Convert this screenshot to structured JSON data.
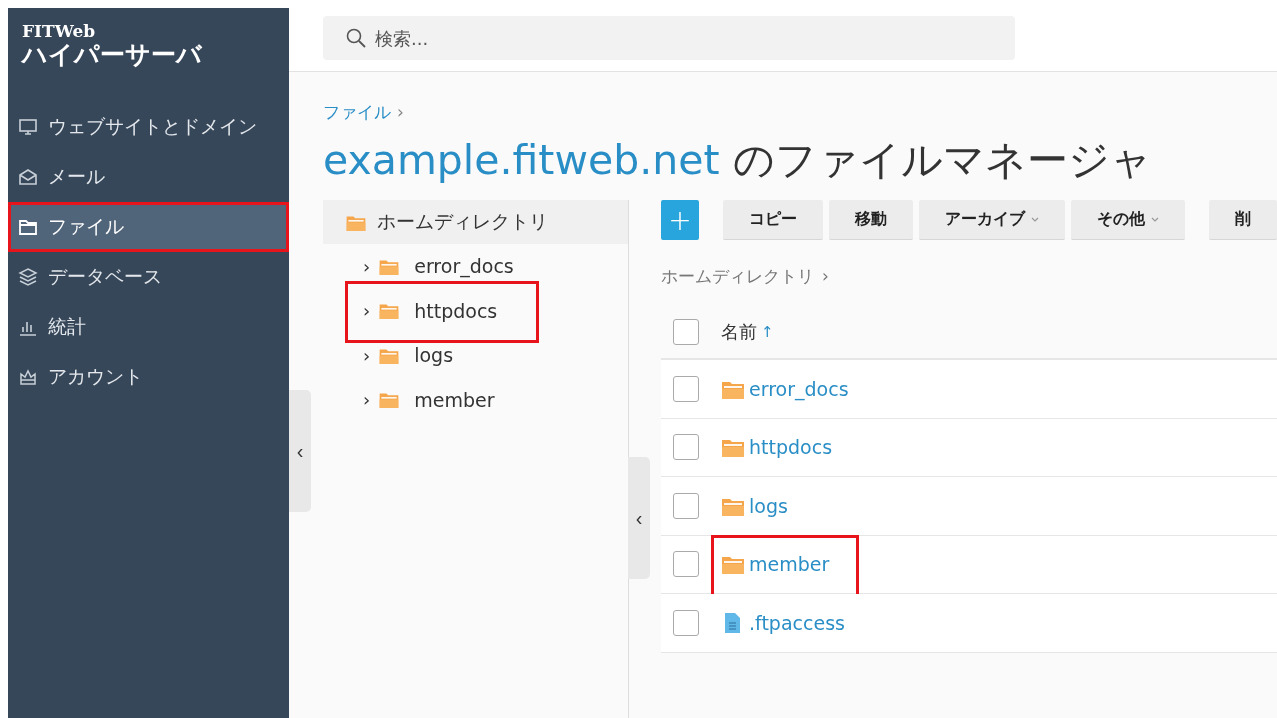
{
  "sidebar": {
    "brand_small": "FITWeb",
    "brand_large": "ハイパーサーバ",
    "items": [
      {
        "kind": "monitor",
        "label": "ウェブサイトとドメイン",
        "selected": false,
        "highlighted": false
      },
      {
        "kind": "mail",
        "label": "メール",
        "selected": false,
        "highlighted": false
      },
      {
        "kind": "folder",
        "label": "ファイル",
        "selected": true,
        "highlighted": true
      },
      {
        "kind": "layers",
        "label": "データベース",
        "selected": false,
        "highlighted": false
      },
      {
        "kind": "chart",
        "label": "統計",
        "selected": false,
        "highlighted": false
      },
      {
        "kind": "account",
        "label": "アカウント",
        "selected": false,
        "highlighted": false
      }
    ],
    "collapse": "‹"
  },
  "search": {
    "placeholder": "検索..."
  },
  "breadcrumb": {
    "label": "ファイル",
    "separator": "›"
  },
  "title": {
    "domain": "example.fitweb.net",
    "suffix": " のファイルマネージャ"
  },
  "tree": {
    "root": "ホームディレクトリ",
    "root_selected": true,
    "children": [
      {
        "label": "error_docs",
        "expander": "›",
        "highlighted": false
      },
      {
        "label": "httpdocs",
        "expander": "›",
        "highlighted": true
      },
      {
        "label": "logs",
        "expander": "›",
        "highlighted": false
      },
      {
        "label": "member",
        "expander": "›",
        "highlighted": false
      }
    ],
    "collapse": "‹"
  },
  "toolbar": {
    "add": "+",
    "buttons": [
      {
        "label": "コピー",
        "dropdown": false
      },
      {
        "label": "移動",
        "dropdown": false
      },
      {
        "label": "アーカイブ",
        "dropdown": true
      },
      {
        "label": "その他",
        "dropdown": true
      },
      {
        "label": "削",
        "dropdown": false
      }
    ]
  },
  "path": {
    "label": "ホームディレクトリ",
    "separator": "›"
  },
  "table": {
    "all_checked": false,
    "column": "名前",
    "sort": "↑",
    "rows": [
      {
        "kind": "folder",
        "name": "error_docs",
        "checked": false,
        "highlighted": false
      },
      {
        "kind": "folder",
        "name": "httpdocs",
        "checked": false,
        "highlighted": false
      },
      {
        "kind": "folder",
        "name": "logs",
        "checked": false,
        "highlighted": false
      },
      {
        "kind": "folder",
        "name": "member",
        "checked": false,
        "highlighted": true
      },
      {
        "kind": "file",
        "name": ".ftpaccess",
        "checked": false,
        "highlighted": false
      }
    ]
  }
}
